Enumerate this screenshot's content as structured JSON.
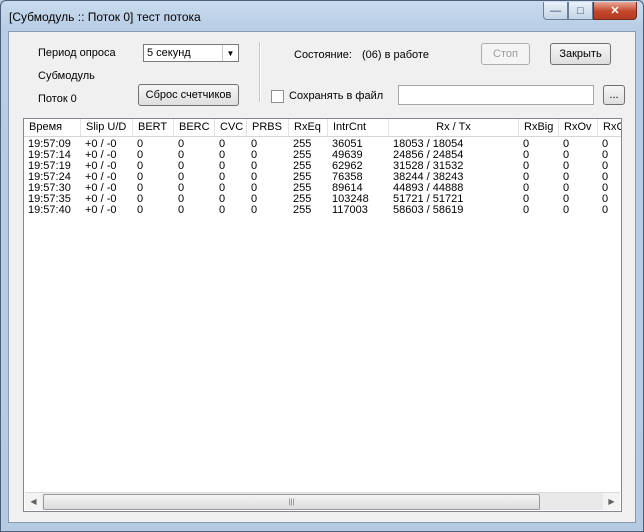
{
  "window": {
    "title": "[Субмодуль :: Поток 0]  тест потока",
    "minimize_glyph": "—",
    "maximize_glyph": "□",
    "close_glyph": "✕"
  },
  "controls": {
    "poll_period_label": "Период опроса",
    "poll_period_value": "5 секунд",
    "submodule_label": "Субмодуль",
    "stream_label": "Поток 0",
    "reset_counters_button": "Сброс счетчиков",
    "state_label": "Состояние:",
    "state_value": "(06) в работе",
    "stop_button": "Стоп",
    "close_button": "Закрыть",
    "save_to_file_label": "Сохранять в файл",
    "save_to_file_checked": false,
    "file_path_value": "",
    "browse_button": "..."
  },
  "table": {
    "columns": [
      "Время",
      "Slip U/D",
      "BERT",
      "BERC",
      "CVC",
      "PRBS",
      "RxEq",
      "IntrCnt",
      "Rx / Tx",
      "RxBig",
      "RxOv",
      "RxC"
    ],
    "rows": [
      [
        "19:57:09",
        "+0 / -0",
        "0",
        "0",
        "0",
        "0",
        "255",
        "36051",
        "18053 / 18054",
        "0",
        "0",
        "0"
      ],
      [
        "19:57:14",
        "+0 / -0",
        "0",
        "0",
        "0",
        "0",
        "255",
        "49639",
        "24856 / 24854",
        "0",
        "0",
        "0"
      ],
      [
        "19:57:19",
        "+0 / -0",
        "0",
        "0",
        "0",
        "0",
        "255",
        "62962",
        "31528 / 31532",
        "0",
        "0",
        "0"
      ],
      [
        "19:57:24",
        "+0 / -0",
        "0",
        "0",
        "0",
        "0",
        "255",
        "76358",
        "38244 / 38243",
        "0",
        "0",
        "0"
      ],
      [
        "19:57:30",
        "+0 / -0",
        "0",
        "0",
        "0",
        "0",
        "255",
        "89614",
        "44893 / 44888",
        "0",
        "0",
        "0"
      ],
      [
        "19:57:35",
        "+0 / -0",
        "0",
        "0",
        "0",
        "0",
        "255",
        "103248",
        "51721 / 51721",
        "0",
        "0",
        "0"
      ],
      [
        "19:57:40",
        "+0 / -0",
        "0",
        "0",
        "0",
        "0",
        "255",
        "117003",
        "58603 / 58619",
        "0",
        "0",
        "0"
      ]
    ]
  },
  "icons": {
    "combo_arrow": "chevron-down-icon",
    "scroll_left": "arrow-left-icon",
    "scroll_right": "arrow-right-icon"
  }
}
